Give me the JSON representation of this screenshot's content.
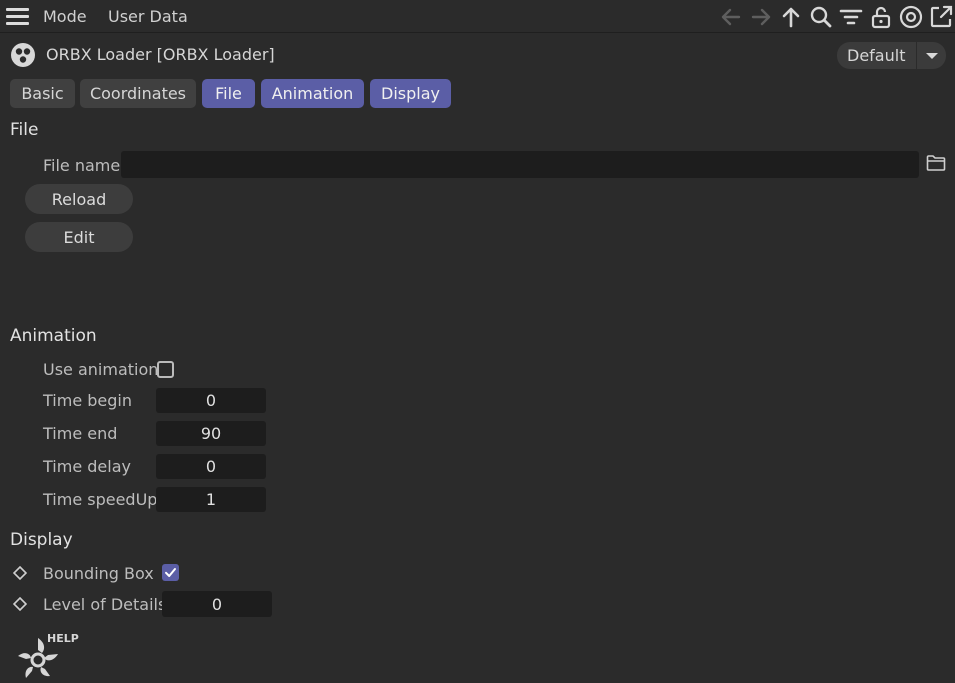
{
  "menubar": {
    "mode_label": "Mode",
    "user_data_label": "User Data",
    "icons": [
      "menu-icon",
      "back-arrow-icon",
      "forward-arrow-icon",
      "up-arrow-icon",
      "search-icon",
      "filter-icon",
      "lock-icon",
      "target-icon",
      "new-window-icon"
    ]
  },
  "object": {
    "title": "ORBX Loader [ORBX Loader]",
    "preset": "Default"
  },
  "tabs": [
    {
      "label": "Basic",
      "active": false
    },
    {
      "label": "Coordinates",
      "active": false
    },
    {
      "label": "File",
      "active": true
    },
    {
      "label": "Animation",
      "active": true
    },
    {
      "label": "Display",
      "active": true
    }
  ],
  "file": {
    "section_title": "File",
    "file_name_label": "File name",
    "file_name_value": "",
    "reload_label": "Reload",
    "edit_label": "Edit"
  },
  "animation": {
    "section_title": "Animation",
    "use_animation_label": "Use animation",
    "use_animation_checked": false,
    "time_begin_label": "Time begin",
    "time_begin_value": "0",
    "time_end_label": "Time end",
    "time_end_value": "90",
    "time_delay_label": "Time delay",
    "time_delay_value": "0",
    "time_speedup_label": "Time speedUp",
    "time_speedup_value": "1"
  },
  "display": {
    "section_title": "Display",
    "bounding_box_label": "Bounding Box",
    "bounding_box_checked": true,
    "lod_label": "Level of Details",
    "lod_value": "0"
  },
  "help": {
    "label": "HELP"
  },
  "colors": {
    "background": "#2b2b2b",
    "accent": "#5b5ea6",
    "field": "#1d1d1d"
  }
}
